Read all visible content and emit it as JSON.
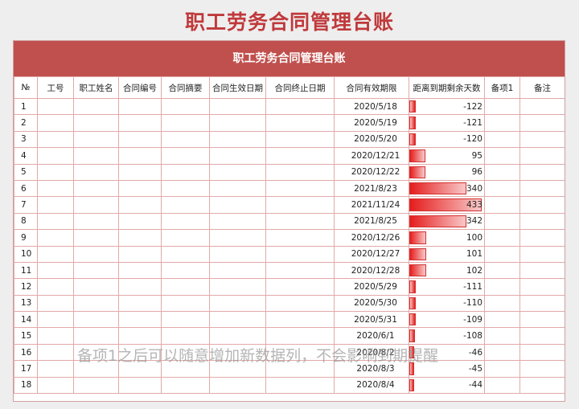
{
  "page_title": "职工劳务合同管理台账",
  "sheet_title": "职工劳务合同管理台账",
  "columns": [
    "№",
    "工号",
    "职工姓名",
    "合同编号",
    "合同摘要",
    "合同生效日期",
    "合同终止日期",
    "合同有效期限",
    "距离到期剩余天数",
    "备项1",
    "备注"
  ],
  "rows": [
    {
      "no": "1",
      "expiry": "2020/5/18",
      "days": -122
    },
    {
      "no": "2",
      "expiry": "2020/5/19",
      "days": -121
    },
    {
      "no": "3",
      "expiry": "2020/5/20",
      "days": -120
    },
    {
      "no": "4",
      "expiry": "2020/12/21",
      "days": 95
    },
    {
      "no": "5",
      "expiry": "2020/12/22",
      "days": 96
    },
    {
      "no": "6",
      "expiry": "2021/8/23",
      "days": 340
    },
    {
      "no": "7",
      "expiry": "2021/11/24",
      "days": 433
    },
    {
      "no": "8",
      "expiry": "2021/8/25",
      "days": 342
    },
    {
      "no": "9",
      "expiry": "2020/12/26",
      "days": 100
    },
    {
      "no": "10",
      "expiry": "2020/12/27",
      "days": 101
    },
    {
      "no": "11",
      "expiry": "2020/12/28",
      "days": 102
    },
    {
      "no": "12",
      "expiry": "2020/5/29",
      "days": -111
    },
    {
      "no": "13",
      "expiry": "2020/5/30",
      "days": -110
    },
    {
      "no": "14",
      "expiry": "2020/5/31",
      "days": -109
    },
    {
      "no": "15",
      "expiry": "2020/6/1",
      "days": -108
    },
    {
      "no": "16",
      "expiry": "2020/8/2",
      "days": -46
    },
    {
      "no": "17",
      "expiry": "2020/8/3",
      "days": -45
    },
    {
      "no": "18",
      "expiry": "2020/8/4",
      "days": -44
    }
  ],
  "bar_colors": {
    "strong": "#e51d1d",
    "light": "#f9c8c8",
    "border": "#d43030"
  },
  "watermark": "备项1之后可以随意增加新数据列，不会影响到期提醒"
}
